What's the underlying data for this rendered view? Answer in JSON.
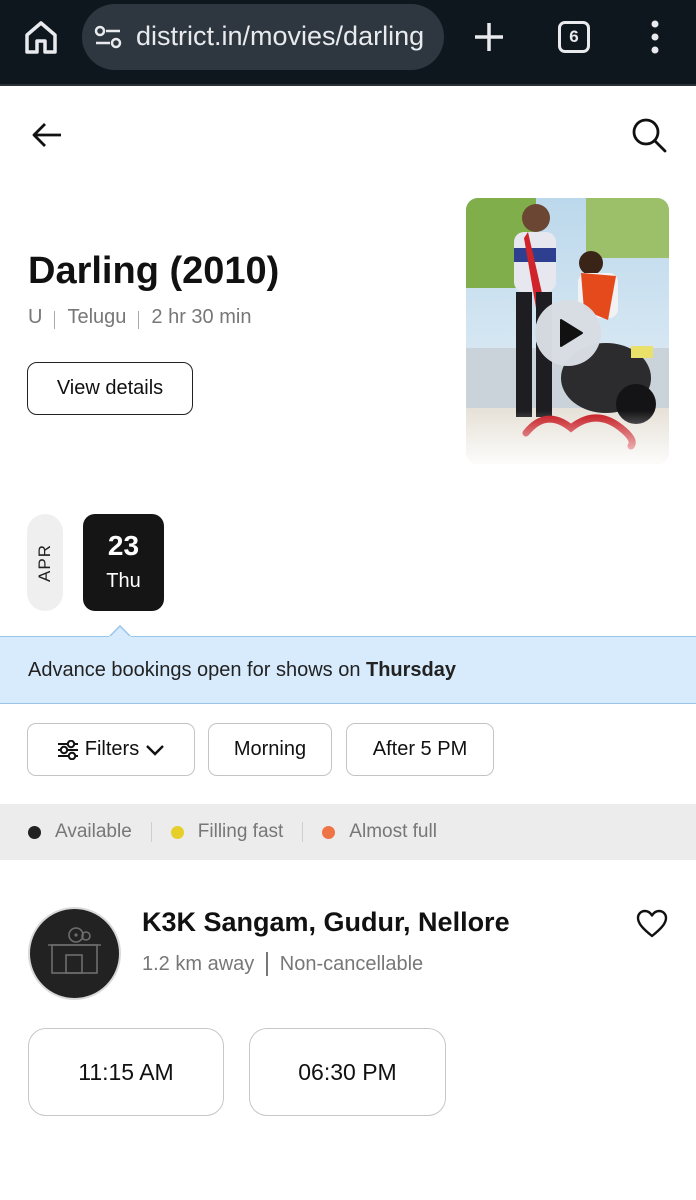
{
  "browser": {
    "url": "district.in/movies/darling",
    "tab_count": "6",
    "icons": [
      "home-icon",
      "site-settings-icon",
      "new-tab-plus-icon",
      "tab-switcher-icon",
      "more-vert-icon"
    ]
  },
  "header": {
    "icons": [
      "back-arrow-icon",
      "search-icon"
    ]
  },
  "movie": {
    "title": "Darling (2010)",
    "rating": "U",
    "language": "Telugu",
    "duration": "2 hr 30 min",
    "view_details_label": "View details",
    "poster_icon": "play-icon"
  },
  "date_picker": {
    "month": "APR",
    "selected": {
      "day": "23",
      "weekday": "Thu"
    }
  },
  "banner": {
    "text": "Advance bookings open for shows on ",
    "emphasis": "Thursday"
  },
  "filters": {
    "filters_label": "Filters",
    "chips": [
      "Morning",
      "After 5 PM"
    ]
  },
  "legend": [
    {
      "label": "Available",
      "color": "#222222"
    },
    {
      "label": "Filling fast",
      "color": "#e6cf2a"
    },
    {
      "label": "Almost full",
      "color": "#ee7446"
    }
  ],
  "cinema": {
    "name": "K3K Sangam, Gudur, Nellore",
    "distance": "1.2 km away",
    "policy": "Non-cancellable",
    "showtimes": [
      "11:15 AM",
      "06:30 PM"
    ]
  },
  "colors": {
    "banner_bg": "#d7ebfc",
    "selected_date_bg": "#151515",
    "chrome_bg": "#0f171e"
  }
}
